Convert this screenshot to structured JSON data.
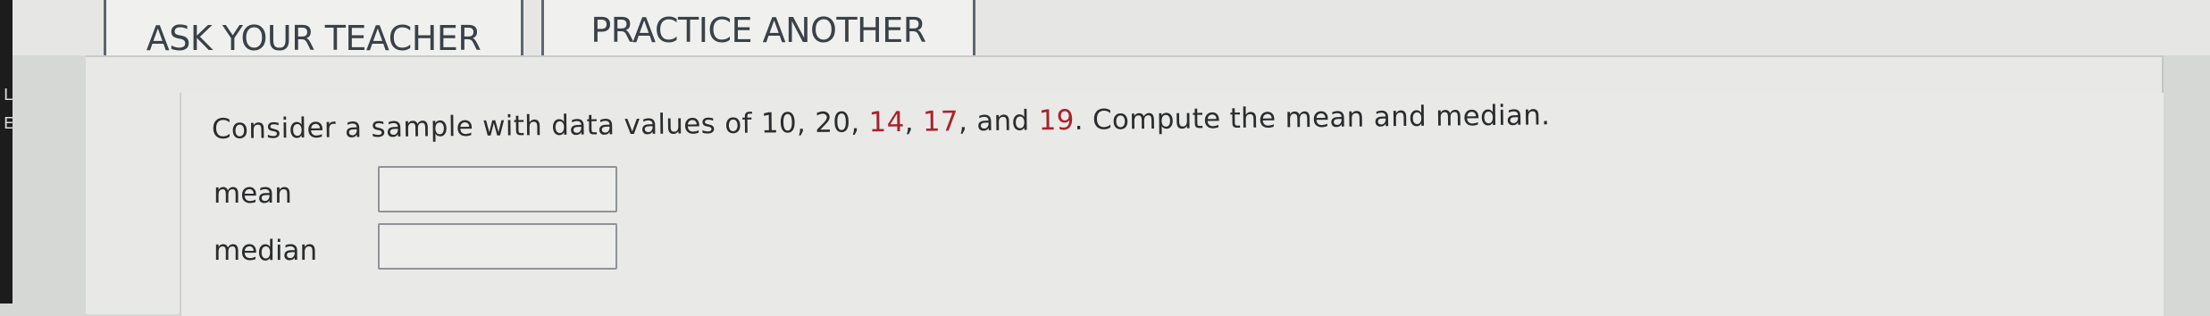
{
  "edge": {
    "glyph_top": "L",
    "glyph_bottom": "E"
  },
  "buttons": {
    "ask_label": "ASK YOUR TEACHER",
    "practice_label": "PRACTICE ANOTHER"
  },
  "question": {
    "prefix": "Consider a sample with data values of 10, 20, ",
    "highlight_1": "14",
    "sep_1": ", ",
    "highlight_2": "17",
    "sep_2": ", and ",
    "highlight_3": "19",
    "suffix": ". Compute the mean and median."
  },
  "fields": {
    "mean_label": "mean",
    "mean_value": "",
    "median_label": "median",
    "median_value": ""
  },
  "colors": {
    "highlight": "#a8232b",
    "button_border": "#5d6670",
    "background": "#e8e9e7"
  }
}
